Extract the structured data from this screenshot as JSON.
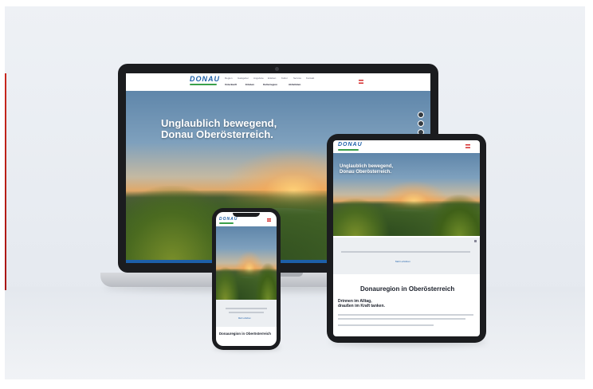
{
  "brand": {
    "logo": "DONAU",
    "accent": "#1d5fa8",
    "wave": "#3aa04a"
  },
  "laptop": {
    "nav_items": [
      "Region",
      "Gastgeber",
      "Angebote",
      "Erleben",
      "Kultur",
      "Service",
      "Kontakt"
    ],
    "main_nav": [
      "Unterkunft",
      "Erleben",
      "Kulturregion",
      "Aktivitäten"
    ],
    "hero_line1": "Unglaublich bewegend,",
    "hero_line2": "Donau Oberösterreich."
  },
  "tablet": {
    "hero_line1": "Unglaublich bewegend,",
    "hero_line2": "Donau Oberösterreich.",
    "notice_link": "Mehr erfahren",
    "section_title": "Donauregion in Oberösterreich",
    "sub_line1": "Drinnen im Alltag,",
    "sub_line2": "draußen im Kraft tanken."
  },
  "phone": {
    "notice_link": "Mehr erfahren",
    "section_title": "Donauregion in Oberösterreich"
  }
}
